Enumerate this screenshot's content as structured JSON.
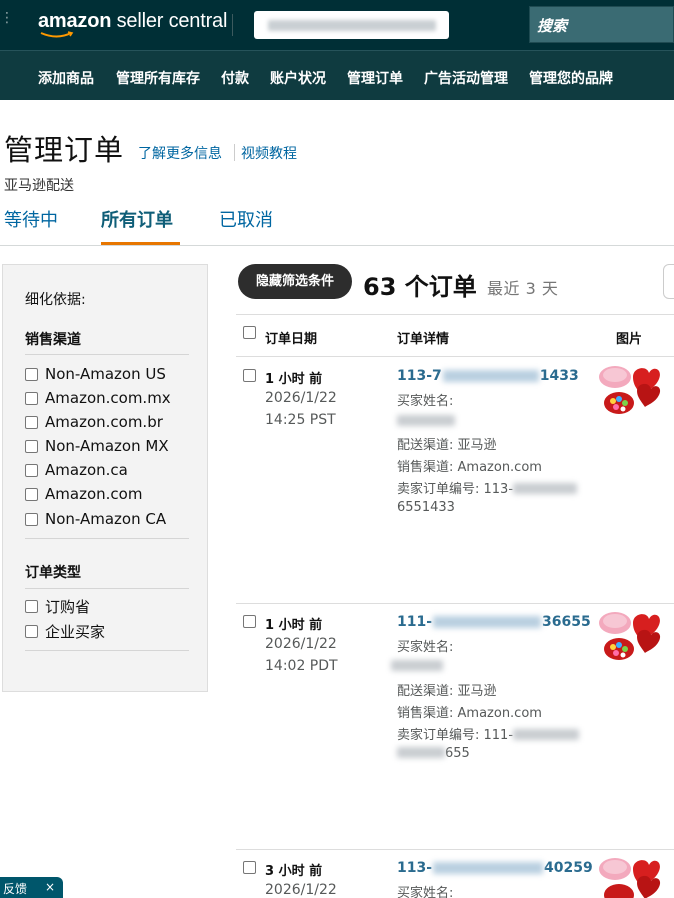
{
  "header": {
    "logo_main": "amazon",
    "logo_sub": "seller central",
    "search_placeholder": "搜索"
  },
  "nav": {
    "items": [
      "添加商品",
      "管理所有库存",
      "付款",
      "账户状况",
      "管理订单",
      "广告活动管理",
      "管理您的品牌"
    ]
  },
  "page": {
    "title": "管理订单",
    "learn_more": "了解更多信息",
    "video_tutorial": "视频教程",
    "fulfillment_note": "亚马逊配送"
  },
  "tabs": [
    {
      "label": "等待中",
      "active": false
    },
    {
      "label": "所有订单",
      "active": true
    },
    {
      "label": "已取消",
      "active": false
    }
  ],
  "filters": {
    "heading": "细化依据:",
    "sales_channel_title": "销售渠道",
    "sales_channels": [
      "Non-Amazon US",
      "Amazon.com.mx",
      "Amazon.com.br",
      "Non-Amazon MX",
      "Amazon.ca",
      "Amazon.com",
      "Non-Amazon CA"
    ],
    "order_type_title": "订单类型",
    "order_types": [
      "订购省",
      "企业买家"
    ]
  },
  "orders_header": {
    "hide_filters_button": "隐藏筛选条件",
    "count_text": "63 个订单",
    "range_text": "最近 3 天"
  },
  "table": {
    "columns": [
      "订单日期",
      "订单详情",
      "图片"
    ]
  },
  "orders": [
    {
      "ago": "1 小时 前",
      "date": "2026/1/22",
      "time": "14:25 PST",
      "id_prefix": "113-7",
      "id_suffix": "1433",
      "buyer_label": "买家姓名:",
      "channel_line": "配送渠道: 亚马逊",
      "sales_line": "销售渠道: Amazon.com",
      "seller_order_label": "卖家订单编号: 113-",
      "seller_order_tail": "6551433"
    },
    {
      "ago": "1 小时 前",
      "date": "2026/1/22",
      "time": "14:02 PDT",
      "id_prefix": "111-",
      "id_suffix": "36655",
      "buyer_label": "买家姓名:",
      "channel_line": "配送渠道: 亚马逊",
      "sales_line": "销售渠道: Amazon.com",
      "seller_order_label": "卖家订单编号: 111-",
      "seller_order_tail": "655"
    },
    {
      "ago": "3 小时 前",
      "date": "2026/1/22",
      "id_prefix": "113-",
      "id_suffix": "40259",
      "buyer_label": "买家姓名:"
    }
  ],
  "feedback": {
    "label": "反馈",
    "close": "×"
  },
  "colors": {
    "topbar": "#002f36",
    "navbar": "#0f3b40",
    "link": "#0066a1",
    "tab_underline": "#e77600"
  }
}
